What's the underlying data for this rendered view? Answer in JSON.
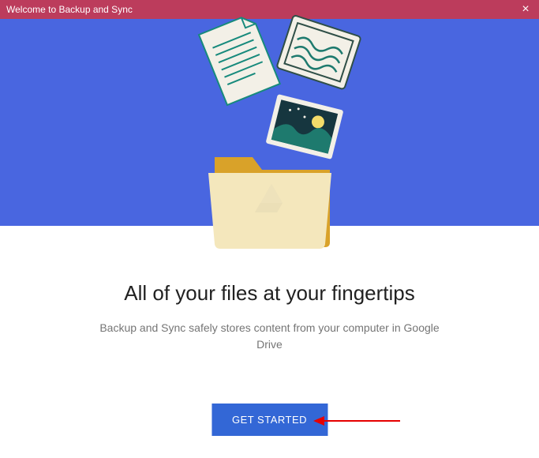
{
  "titlebar": {
    "title": "Welcome to Backup and Sync"
  },
  "content": {
    "heading": "All of your files at your fingertips",
    "subheading": "Backup and Sync safely stores content from your computer in Google Drive"
  },
  "cta": {
    "label": "GET STARTED"
  }
}
